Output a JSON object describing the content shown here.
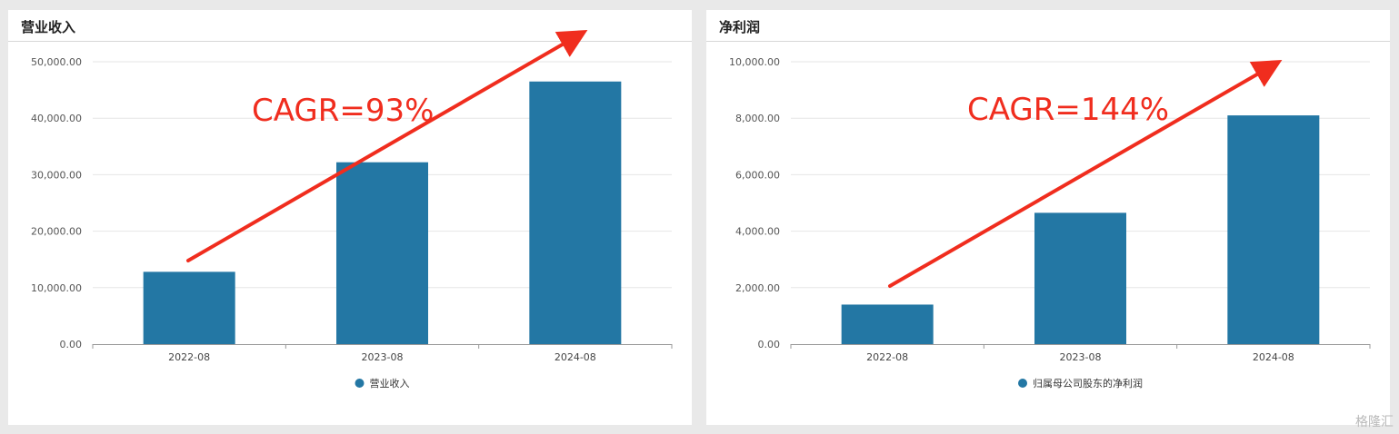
{
  "chart_data": [
    {
      "type": "bar",
      "title": "营业收入",
      "categories": [
        "2022-08",
        "2023-08",
        "2024-08"
      ],
      "series": [
        {
          "name": "营业收入",
          "values": [
            12800,
            32200,
            46500
          ]
        }
      ],
      "ylim": [
        0,
        50000
      ],
      "yticks": [
        "0.00",
        "10,000.00",
        "20,000.00",
        "30,000.00",
        "40,000.00",
        "50,000.00"
      ],
      "grid": true,
      "legend": "bottom-center",
      "annotation": "CAGR=93%",
      "bar_color": "#2377a4",
      "annotation_color": "#f02d1e"
    },
    {
      "type": "bar",
      "title": "净利润",
      "categories": [
        "2022-08",
        "2023-08",
        "2024-08"
      ],
      "series": [
        {
          "name": "归属母公司股东的净利润",
          "values": [
            1400,
            4650,
            8100
          ]
        }
      ],
      "ylim": [
        0,
        10000
      ],
      "yticks": [
        "0.00",
        "2,000.00",
        "4,000.00",
        "6,000.00",
        "8,000.00",
        "10,000.00"
      ],
      "grid": true,
      "legend": "bottom-center",
      "annotation": "CAGR=144%",
      "bar_color": "#2377a4",
      "annotation_color": "#f02d1e"
    }
  ],
  "watermark": "格隆汇"
}
